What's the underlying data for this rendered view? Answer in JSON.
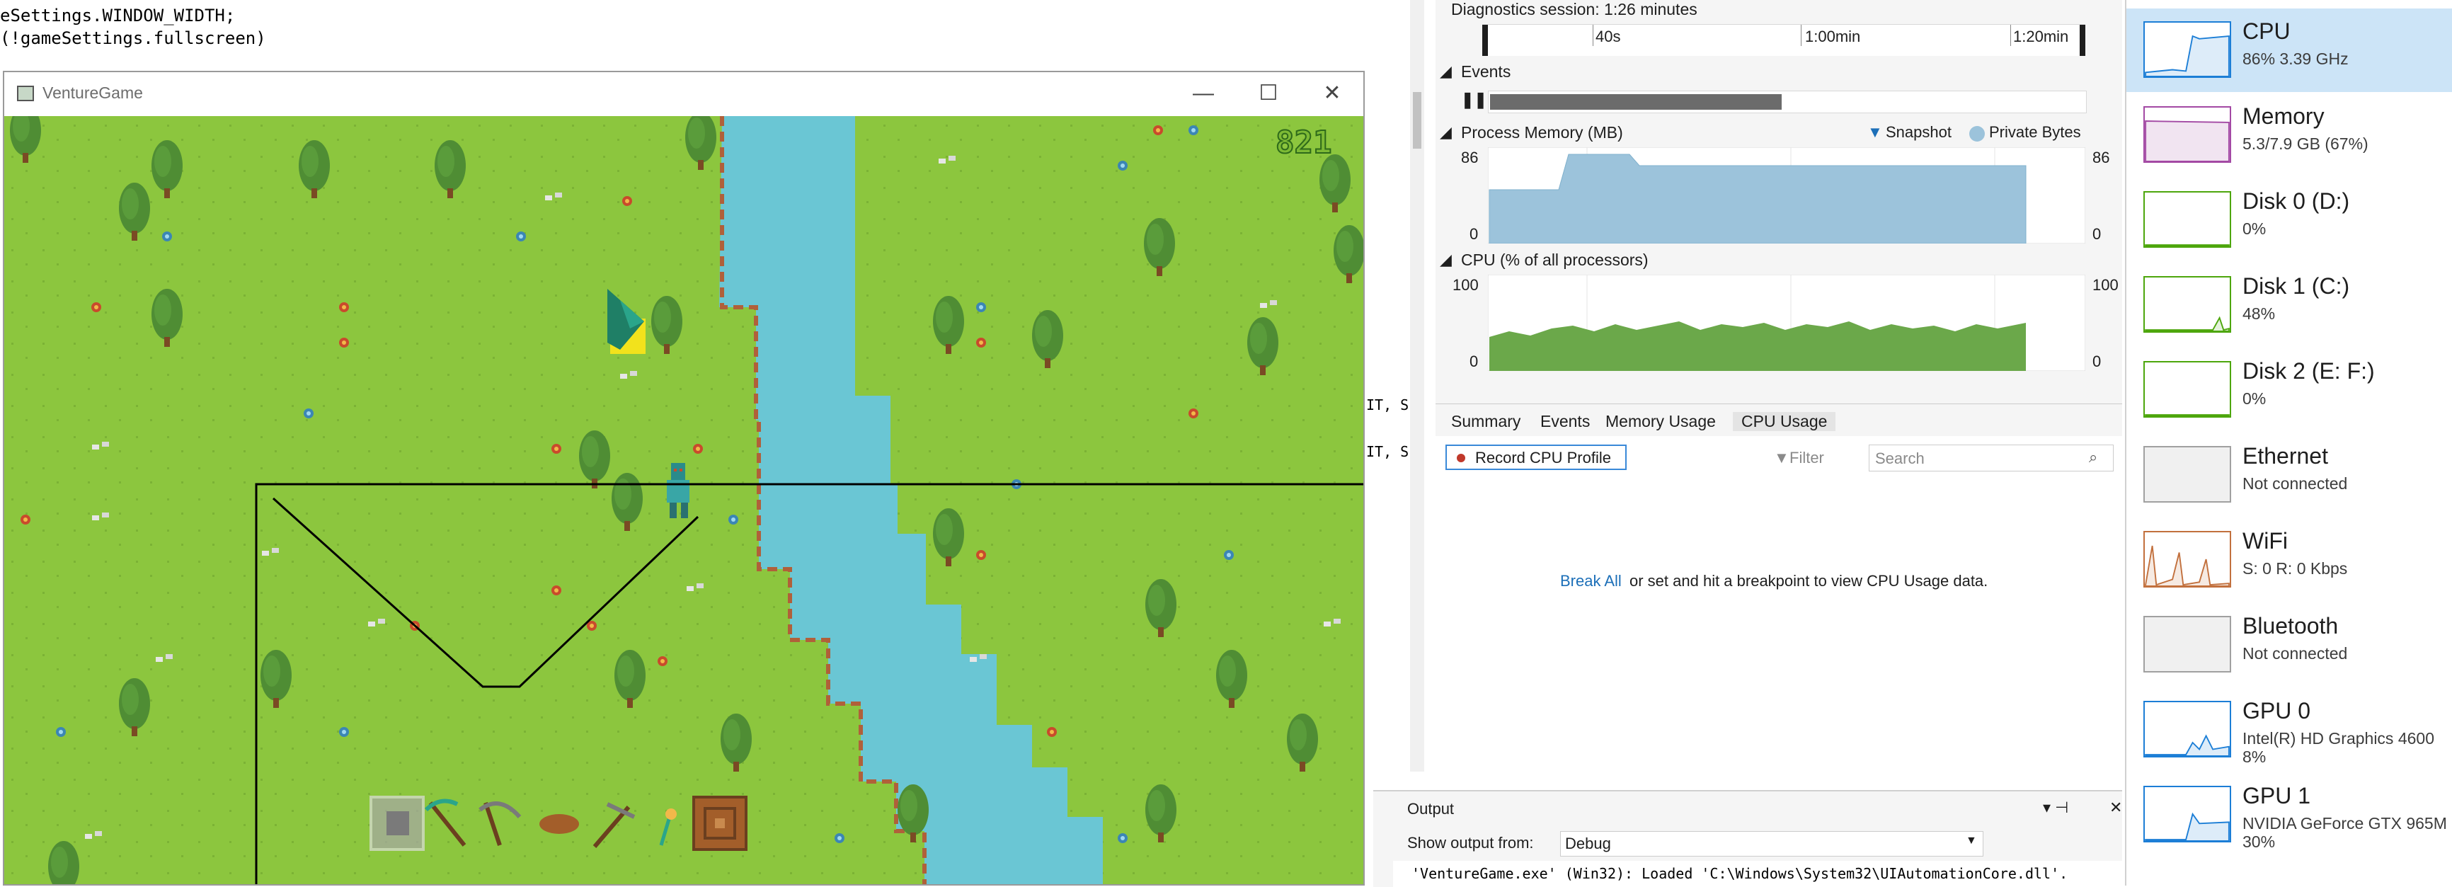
{
  "editor": {
    "lines": [
      "eSettings.WINDOW_WIDTH;",
      "(!gameSettings.fullscreen)"
    ],
    "right_fragments": [
      "IT, S",
      "IT, S"
    ]
  },
  "game_window": {
    "title": "VentureGame",
    "minimize": "—",
    "maximize": "☐",
    "close": "✕",
    "fps": "821",
    "colors": {
      "grass": "#8cc63e",
      "water": "#6ac6d4",
      "hud_line": "#000000"
    }
  },
  "diagnostics": {
    "session": "Diagnostics session: 1:26 minutes",
    "ticks": [
      "40s",
      "1:00min",
      "1:20min"
    ],
    "events": {
      "label": "Events",
      "progress": 0.49
    },
    "memory": {
      "title": "Process Memory (MB)",
      "legend_snapshot": "Snapshot",
      "legend_private": "Private Bytes",
      "y_max": "86",
      "y_min": "0",
      "y_max_right": "86",
      "y_min_right": "0",
      "color": "#9cc3db"
    },
    "cpu": {
      "title": "CPU (% of all processors)",
      "y_max": "100",
      "y_min": "0",
      "y_max_right": "100",
      "y_min_right": "0",
      "color": "#6ba84a"
    },
    "tabs": [
      "Summary",
      "Events",
      "Memory Usage",
      "CPU Usage"
    ],
    "record_button": "Record CPU Profile",
    "filter_label": "Filter",
    "search_placeholder": "Search",
    "break_all": "Break All",
    "break_message": "or set and hit a breakpoint to view CPU Usage data."
  },
  "output": {
    "title": "Output",
    "show_from_label": "Show output from:",
    "source": "Debug",
    "log_line": "'VentureGame.exe' (Win32): Loaded 'C:\\Windows\\System32\\UIAutomationCore.dll'."
  },
  "taskmanager": {
    "items": [
      {
        "name": "CPU",
        "sub": "86%  3.39 GHz",
        "sub2": "",
        "color": "#1c7ed6"
      },
      {
        "name": "Memory",
        "sub": "5.3/7.9 GB (67%)",
        "sub2": "",
        "color": "#a349a4"
      },
      {
        "name": "Disk 0 (D:)",
        "sub": "0%",
        "sub2": "",
        "color": "#4da60c"
      },
      {
        "name": "Disk 1 (C:)",
        "sub": "48%",
        "sub2": "",
        "color": "#4da60c"
      },
      {
        "name": "Disk 2 (E: F:)",
        "sub": "0%",
        "sub2": "",
        "color": "#4da60c"
      },
      {
        "name": "Ethernet",
        "sub": "Not connected",
        "sub2": "",
        "color": "#a0a0a0"
      },
      {
        "name": "WiFi",
        "sub": "S: 0  R: 0 Kbps",
        "sub2": "",
        "color": "#c2703d"
      },
      {
        "name": "Bluetooth",
        "sub": "Not connected",
        "sub2": "",
        "color": "#a0a0a0"
      },
      {
        "name": "GPU 0",
        "sub": "Intel(R) HD Graphics 4600",
        "sub2": "8%",
        "color": "#1c7ed6"
      },
      {
        "name": "GPU 1",
        "sub": "NVIDIA GeForce GTX 965M",
        "sub2": "30%",
        "color": "#1c7ed6"
      }
    ]
  }
}
